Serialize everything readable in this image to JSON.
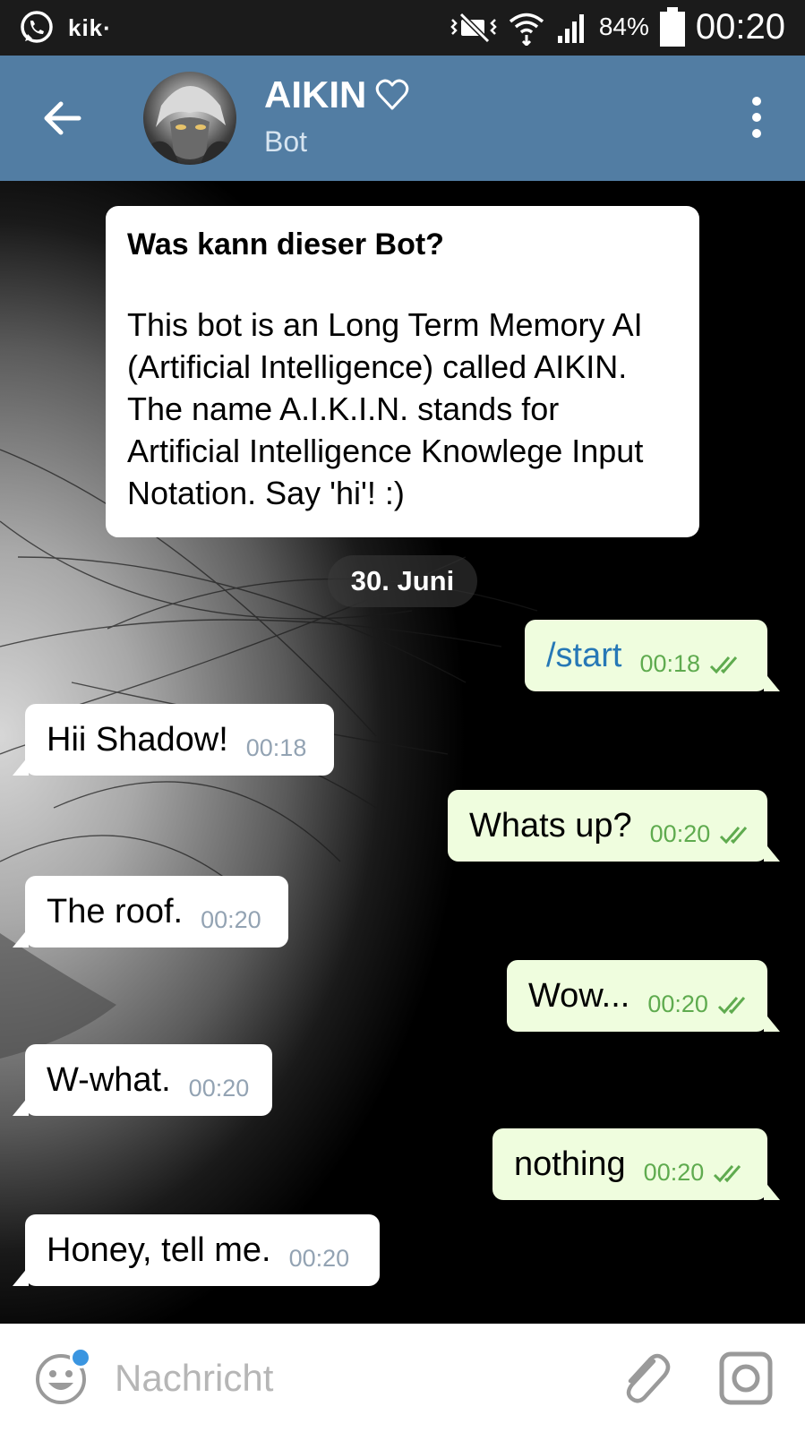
{
  "status_bar": {
    "notifications": [
      "whatsapp-icon",
      "kik-icon"
    ],
    "kik_label": "kik·",
    "battery_percent": "84%",
    "time": "00:20",
    "icons": [
      "mute-vibrate-icon",
      "wifi-icon",
      "signal-icon",
      "battery-icon"
    ]
  },
  "header": {
    "title": "AIKIN",
    "subtitle": "Bot",
    "back_icon": "arrow-left-icon",
    "menu_icon": "more-vert-icon",
    "title_icon": "heart-outline-icon"
  },
  "bot_info": {
    "title": "Was kann dieser Bot?",
    "body": "This bot is an Long Term Memory AI (Artificial Intelligence) called AIKIN. The name A.I.K.I.N. stands for Artificial Intelligence Knowlege Input Notation. Say 'hi'! :)"
  },
  "date_divider": "30. Juni",
  "messages": [
    {
      "direction": "out",
      "text": "/start",
      "time": "00:18",
      "read": true
    },
    {
      "direction": "in",
      "text": "Hii Shadow!",
      "time": "00:18"
    },
    {
      "direction": "out",
      "text": "Whats up?",
      "time": "00:20",
      "read": true
    },
    {
      "direction": "in",
      "text": "The roof.",
      "time": "00:20"
    },
    {
      "direction": "out",
      "text": "Wow...",
      "time": "00:20",
      "read": true
    },
    {
      "direction": "in",
      "text": "W-what.",
      "time": "00:20"
    },
    {
      "direction": "out",
      "text": "nothing",
      "time": "00:20",
      "read": true
    },
    {
      "direction": "in",
      "text": "Honey, tell me.",
      "time": "00:20"
    }
  ],
  "composer": {
    "placeholder": "Nachricht",
    "value": "",
    "icons": [
      "emoji-icon",
      "paperclip-icon",
      "camera-icon"
    ]
  },
  "colors": {
    "app_bar": "#527da3",
    "incoming_bubble": "#ffffff",
    "outgoing_bubble": "#effdde",
    "outgoing_time": "#5fab4f",
    "incoming_time": "#93a3b3",
    "command_link": "#2678b6",
    "unread_dot": "#3a95e0"
  }
}
